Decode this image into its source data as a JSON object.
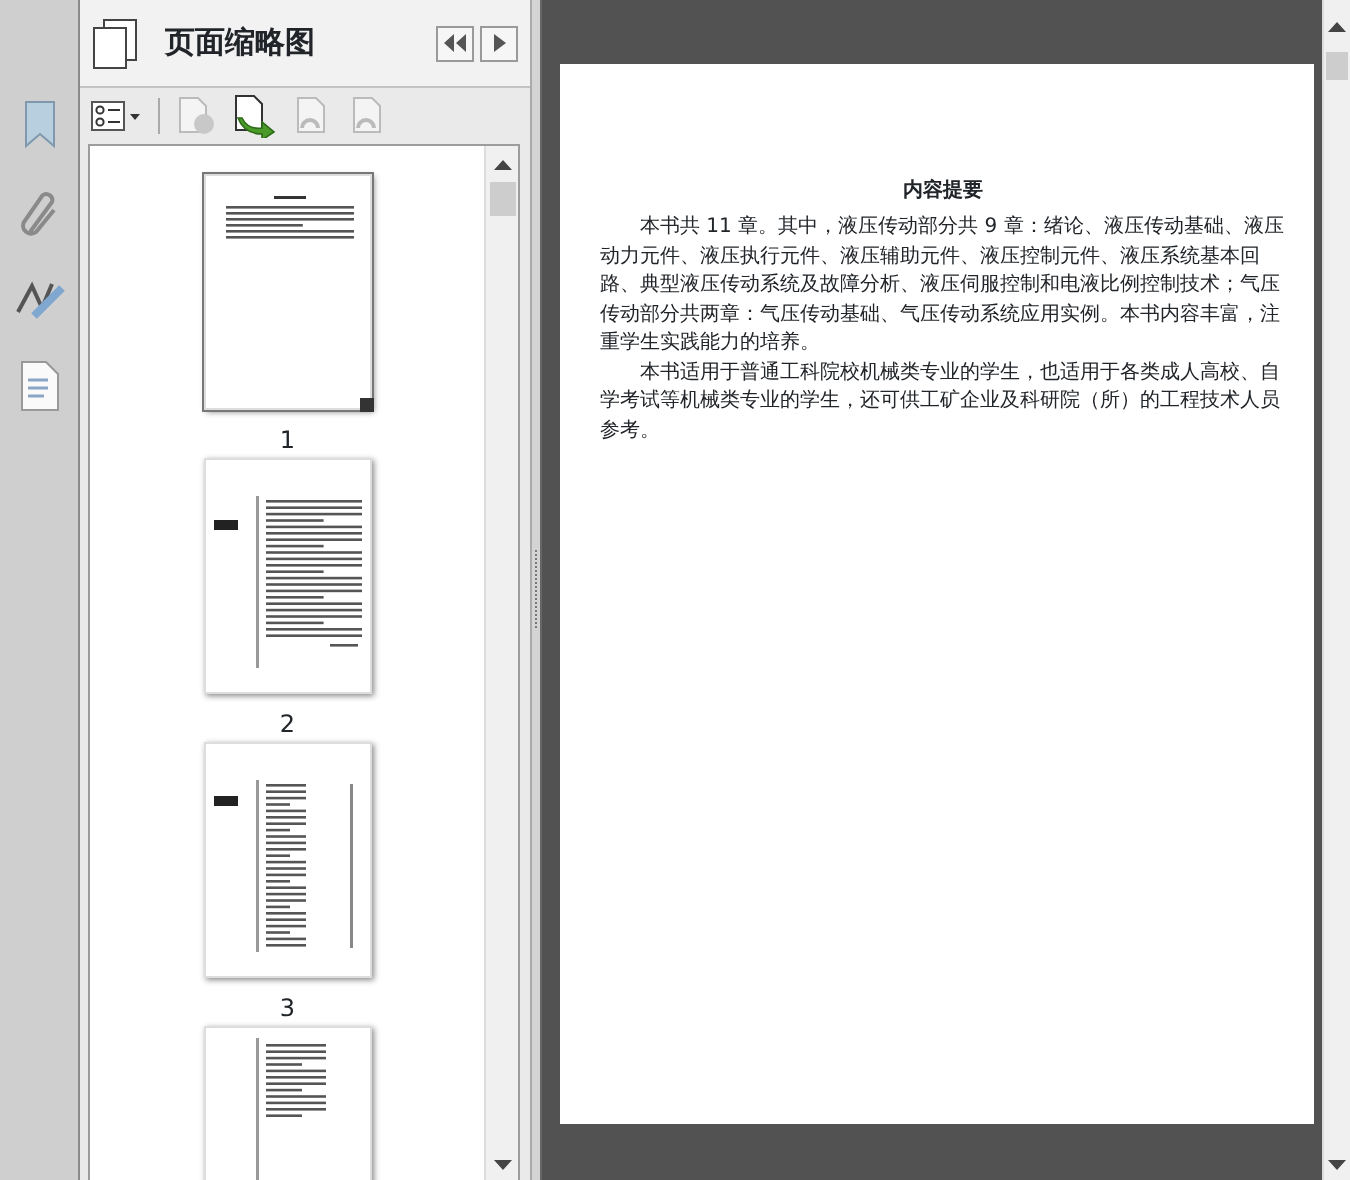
{
  "panel": {
    "title": "页面缩略图"
  },
  "thumbnails": [
    {
      "label": "1",
      "selected": true,
      "kind": "text"
    },
    {
      "label": "2",
      "selected": false,
      "kind": "preface"
    },
    {
      "label": "3",
      "selected": false,
      "kind": "contents"
    }
  ],
  "document": {
    "heading": "内容提要",
    "paragraphs": [
      "本书共 11 章。其中，液压传动部分共 9 章：绪论、液压传动基础、液压动力元件、液压执行元件、液压辅助元件、液压控制元件、液压系统基本回路、典型液压传动系统及故障分析、液压伺服控制和电液比例控制技术；气压传动部分共两章：气压传动基础、气压传动系统应用实例。本书内容丰富，注重学生实践能力的培养。",
      "本书适用于普通工科院校机械类专业的学生，也适用于各类成人高校、自学考试等机械类专业的学生，还可供工矿企业及科研院（所）的工程技术人员参考。"
    ]
  }
}
